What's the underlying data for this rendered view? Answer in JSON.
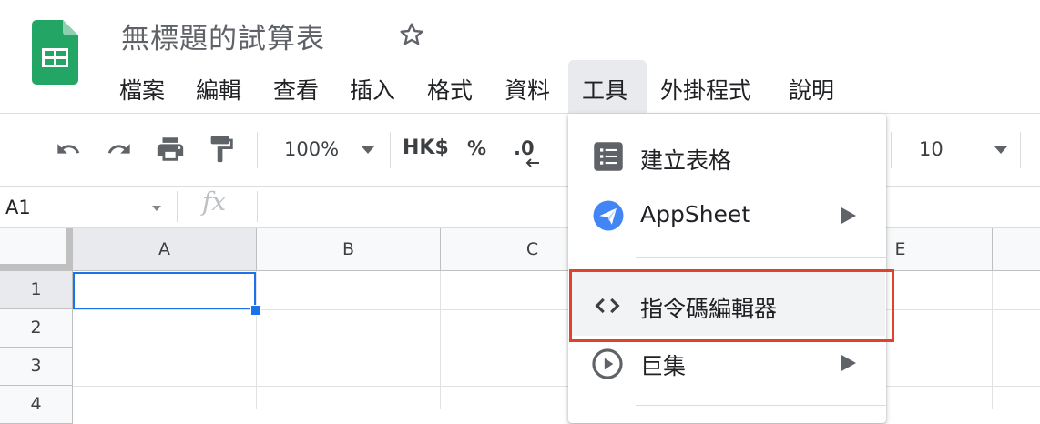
{
  "app": {
    "doc_title": "無標題的試算表",
    "logo_icon": "google-sheets-logo",
    "brand_color": "#23a566"
  },
  "menubar": {
    "items": [
      "檔案",
      "編輯",
      "查看",
      "插入",
      "格式",
      "資料",
      "工具",
      "外掛程式",
      "說明"
    ],
    "active": "工具"
  },
  "toolbar": {
    "zoom": "100%",
    "currency": "HK$",
    "percent": "%",
    "decimal": ".0",
    "font_size": "10",
    "icons": [
      "undo-icon",
      "redo-icon",
      "print-icon",
      "paint-format-icon"
    ]
  },
  "formula_bar": {
    "name_box": "A1",
    "fx": "fx"
  },
  "grid": {
    "columns": [
      "A",
      "B",
      "C",
      "E"
    ],
    "rows": [
      "1",
      "2",
      "3",
      "4"
    ],
    "selected_cell": "A1",
    "selection_color": "#1a73e8"
  },
  "tools_menu": {
    "items": [
      {
        "label": "建立表格",
        "icon": "form-icon",
        "submenu": false
      },
      {
        "label": "AppSheet",
        "icon": "appsheet-icon",
        "submenu": true
      },
      {
        "label": "指令碼編輯器",
        "icon": "code-icon",
        "submenu": false,
        "highlighted": true
      },
      {
        "label": "巨集",
        "icon": "play-circle-icon",
        "submenu": true
      }
    ],
    "highlight_color": "#e0432c"
  }
}
